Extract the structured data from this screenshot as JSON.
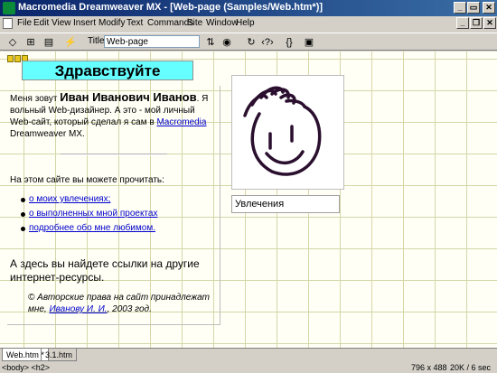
{
  "window": {
    "title": "Macromedia Dreamweaver MX - [Web-page (Samples/Web.htm*)]"
  },
  "menu": [
    "File",
    "Edit",
    "View",
    "Insert",
    "Modify",
    "Text",
    "Commands",
    "Site",
    "Window",
    "Help"
  ],
  "toolbar": {
    "title_label": "Title:",
    "title_value": "Web-page"
  },
  "page": {
    "heading": "Здравствуйте",
    "intro_prefix": "Меня зовут ",
    "intro_name": "Иван Иванович Иванов",
    "intro_middle": ". Я вольный Web-дизайнер. А это - мой личный Web-сайт, который сделал я сам в ",
    "intro_link": "Macromedia",
    "intro_suffix": " Dreamweaver MX.",
    "read_label": "На этом сайте вы можете прочитать:",
    "list": [
      "о моих увлечениях;",
      "о выполненных мной проектах",
      "подробнее обо мне любимом."
    ],
    "links_text": "А здесь вы найдете ссылки на другие интернет-ресурсы.",
    "copy_prefix": "© Авторские права на сайт принадлежат мне, ",
    "copy_link": "Иванову И. И.",
    "copy_suffix": ", 2003 год.",
    "interests_box": "Увлечения"
  },
  "tabs": [
    "Web.htm *",
    "3.1.htm"
  ],
  "status": {
    "tags": "<body> <h2>",
    "window_size": "796 x 488",
    "download": "20K / 6 sec"
  }
}
